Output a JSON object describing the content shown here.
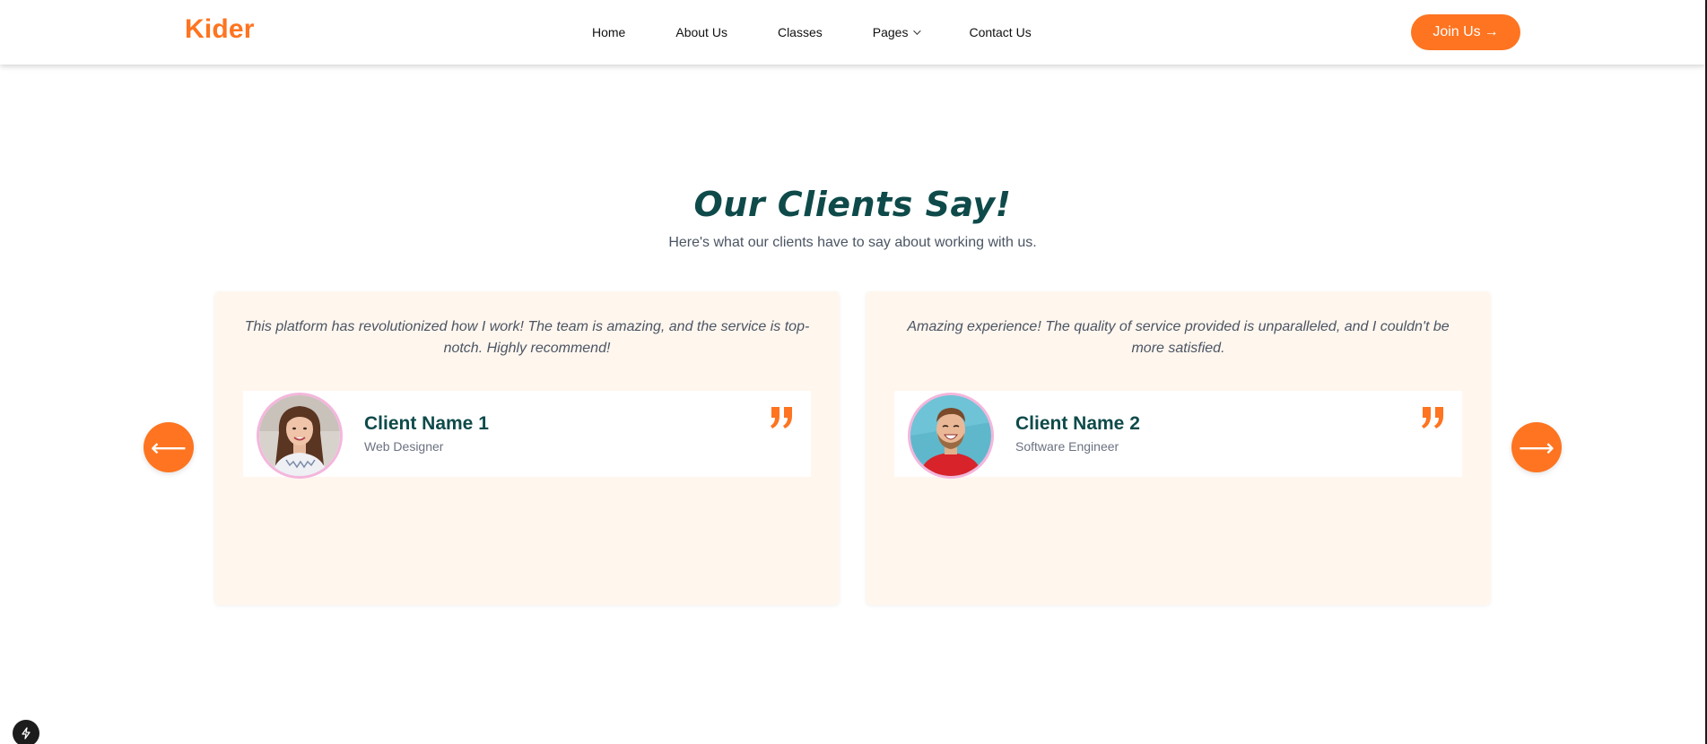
{
  "header": {
    "logo": "Kider",
    "nav": [
      {
        "label": "Home"
      },
      {
        "label": "About Us"
      },
      {
        "label": "Classes"
      },
      {
        "label": "Pages",
        "has_dropdown": true
      },
      {
        "label": "Contact Us"
      }
    ],
    "cta_label": "Join Us",
    "cta_icon": "arrow-right-icon"
  },
  "section": {
    "title": "Our Clients Say!",
    "subtitle": "Here's what our clients have to say about working with us."
  },
  "carousel": {
    "prev_icon": "arrow-left-icon",
    "next_icon": "arrow-right-icon",
    "prev_glyph": "⟵",
    "next_glyph": "⟶",
    "testimonials": [
      {
        "quote": "This platform has revolutionized how I work! The team is amazing, and the service is top-notch. Highly recommend!",
        "name": "Client Name 1",
        "role": "Web Designer",
        "avatar": "woman-portrait-avatar"
      },
      {
        "quote": "Amazing experience! The quality of service provided is unparalleled, and I couldn't be more satisfied.",
        "name": "Client Name 2",
        "role": "Software Engineer",
        "avatar": "laughing-man-portrait-avatar"
      }
    ]
  },
  "colors": {
    "accent": "#fe7420",
    "heading": "#0f4a4a",
    "card_bg": "#fff6ee",
    "avatar_border": "#f4b6dc"
  },
  "badge_icon": "lightning-icon"
}
